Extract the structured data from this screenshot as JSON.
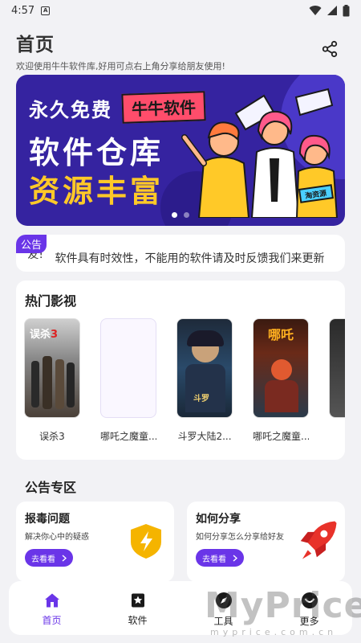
{
  "status_bar": {
    "time": "4:57",
    "notif_glyph": "A"
  },
  "header": {
    "title": "首页",
    "subtitle": "欢迎使用牛牛软件库,好用可点右上角分享给朋友使用!"
  },
  "banner": {
    "line1": "永久免费",
    "tag": "牛牛软件",
    "line2": "软件仓库",
    "line3": "资源丰富",
    "sign": "淘资源",
    "slides": 2,
    "active_slide": 0
  },
  "notice": {
    "badge": "公告",
    "leading_fragment": "友!",
    "text": "软件具有时效性，不能用的软件请及时反馈我们来更新"
  },
  "movies": {
    "title": "热门影视",
    "items": [
      {
        "name": "误杀3"
      },
      {
        "name": "哪吒之魔童..."
      },
      {
        "name": "斗罗大陆2..."
      },
      {
        "name": "哪吒之魔童..."
      }
    ]
  },
  "announcement_section": {
    "title": "公告专区",
    "cards": [
      {
        "title": "报毒问题",
        "desc": "解决你心中的疑惑",
        "button": "去看看"
      },
      {
        "title": "如何分享",
        "desc": "如何分享怎么分享给好友",
        "button": "去看看"
      }
    ]
  },
  "tabbar": {
    "items": [
      {
        "label": "首页",
        "icon": "home-icon",
        "active": true
      },
      {
        "label": "软件",
        "icon": "star-bookmark-icon",
        "active": false
      },
      {
        "label": "工具",
        "icon": "compass-icon",
        "active": false
      },
      {
        "label": "更多",
        "icon": "smile-icon",
        "active": false
      }
    ]
  },
  "watermark": {
    "text": "MyPrice",
    "sub": "myprice.com.cn"
  },
  "colors": {
    "accent": "#6a35e8",
    "banner_bg": "#3523a0",
    "banner_yellow": "#ffc928",
    "tag_red": "#ff4d6b"
  }
}
